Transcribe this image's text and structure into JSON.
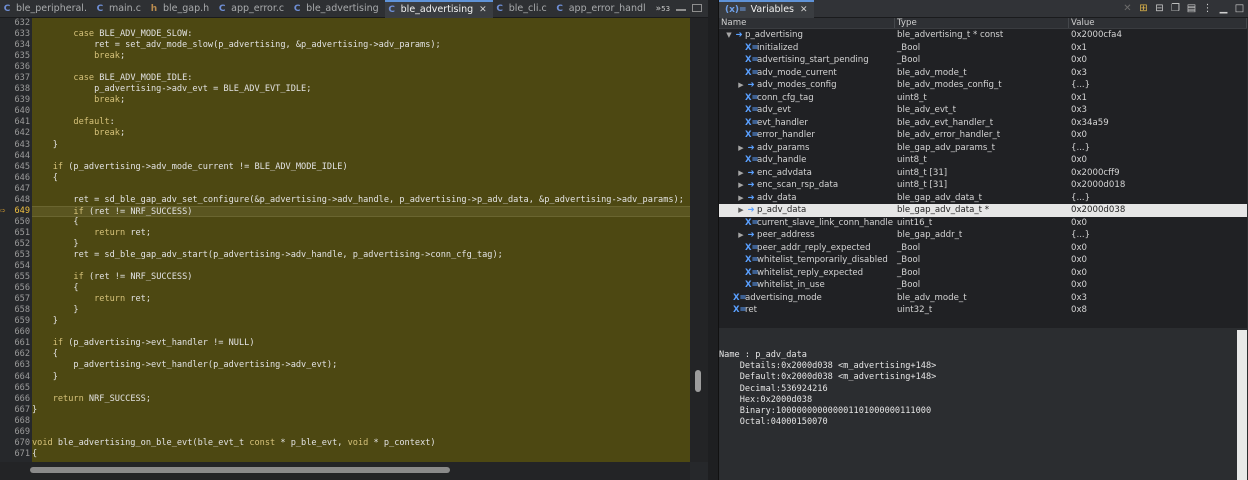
{
  "editor": {
    "tabs": [
      {
        "label": "ble_peripheral.",
        "kind": "c",
        "active": false
      },
      {
        "label": "main.c",
        "kind": "c",
        "active": false
      },
      {
        "label": "ble_gap.h",
        "kind": "h",
        "active": false
      },
      {
        "label": "app_error.c",
        "kind": "c",
        "active": false
      },
      {
        "label": "ble_advertising",
        "kind": "c",
        "active": false
      },
      {
        "label": "ble_advertising",
        "kind": "c",
        "active": true,
        "close": "✕"
      },
      {
        "label": "ble_cli.c",
        "kind": "c",
        "active": false
      },
      {
        "label": "app_error_handl",
        "kind": "c",
        "active": false
      }
    ],
    "overflow": "»",
    "overflow_count": "53",
    "current_line": "649",
    "lines": [
      {
        "n": "632",
        "t": ""
      },
      {
        "n": "633",
        "t": "        case BLE_ADV_MODE_SLOW:"
      },
      {
        "n": "634",
        "t": "            ret = set_adv_mode_slow(p_advertising, &p_advertising->adv_params);"
      },
      {
        "n": "635",
        "t": "            break;"
      },
      {
        "n": "636",
        "t": ""
      },
      {
        "n": "637",
        "t": "        case BLE_ADV_MODE_IDLE:"
      },
      {
        "n": "638",
        "t": "            p_advertising->adv_evt = BLE_ADV_EVT_IDLE;"
      },
      {
        "n": "639",
        "t": "            break;"
      },
      {
        "n": "640",
        "t": ""
      },
      {
        "n": "641",
        "t": "        default:"
      },
      {
        "n": "642",
        "t": "            break;"
      },
      {
        "n": "643",
        "t": "    }"
      },
      {
        "n": "644",
        "t": ""
      },
      {
        "n": "645",
        "t": "    if (p_advertising->adv_mode_current != BLE_ADV_MODE_IDLE)"
      },
      {
        "n": "646",
        "t": "    {"
      },
      {
        "n": "647",
        "t": ""
      },
      {
        "n": "648",
        "t": "        ret = sd_ble_gap_adv_set_configure(&p_advertising->adv_handle, p_advertising->p_adv_data, &p_advertising->adv_params);"
      },
      {
        "n": "649",
        "t": "        if (ret != NRF_SUCCESS)"
      },
      {
        "n": "650",
        "t": "        {"
      },
      {
        "n": "651",
        "t": "            return ret;"
      },
      {
        "n": "652",
        "t": "        }"
      },
      {
        "n": "653",
        "t": "        ret = sd_ble_gap_adv_start(p_advertising->adv_handle, p_advertising->conn_cfg_tag);"
      },
      {
        "n": "654",
        "t": ""
      },
      {
        "n": "655",
        "t": "        if (ret != NRF_SUCCESS)"
      },
      {
        "n": "656",
        "t": "        {"
      },
      {
        "n": "657",
        "t": "            return ret;"
      },
      {
        "n": "658",
        "t": "        }"
      },
      {
        "n": "659",
        "t": "    }"
      },
      {
        "n": "660",
        "t": ""
      },
      {
        "n": "661",
        "t": "    if (p_advertising->evt_handler != NULL)"
      },
      {
        "n": "662",
        "t": "    {"
      },
      {
        "n": "663",
        "t": "        p_advertising->evt_handler(p_advertising->adv_evt);"
      },
      {
        "n": "664",
        "t": "    }"
      },
      {
        "n": "665",
        "t": ""
      },
      {
        "n": "666",
        "t": "    return NRF_SUCCESS;"
      },
      {
        "n": "667",
        "t": "}"
      },
      {
        "n": "668",
        "t": ""
      },
      {
        "n": "669",
        "t": ""
      },
      {
        "n": "670",
        "t": "void ble_advertising_on_ble_evt(ble_evt_t const * p_ble_evt, void * p_context)"
      },
      {
        "n": "671",
        "t": "{"
      }
    ]
  },
  "variables": {
    "tab_label": "Variables",
    "tab_icon": "(x)=",
    "columns": {
      "name": "Name",
      "type": "Type",
      "value": "Value"
    },
    "rows": [
      {
        "name": "p_advertising",
        "type": "ble_advertising_t * const",
        "value": "0x2000cfa4",
        "indent": 0,
        "exp": "▼",
        "icon": "➜"
      },
      {
        "name": "initialized",
        "type": "_Bool",
        "value": "0x1",
        "indent": 1,
        "exp": "",
        "icon": "X="
      },
      {
        "name": "advertising_start_pending",
        "type": "_Bool",
        "value": "0x0",
        "indent": 1,
        "exp": "",
        "icon": "X="
      },
      {
        "name": "adv_mode_current",
        "type": "ble_adv_mode_t",
        "value": "0x3",
        "indent": 1,
        "exp": "",
        "icon": "X="
      },
      {
        "name": "adv_modes_config",
        "type": "ble_adv_modes_config_t",
        "value": "{...}",
        "indent": 1,
        "exp": "▶",
        "icon": "➜"
      },
      {
        "name": "conn_cfg_tag",
        "type": "uint8_t",
        "value": "0x1",
        "indent": 1,
        "exp": "",
        "icon": "X="
      },
      {
        "name": "adv_evt",
        "type": "ble_adv_evt_t",
        "value": "0x3",
        "indent": 1,
        "exp": "",
        "icon": "X="
      },
      {
        "name": "evt_handler",
        "type": "ble_adv_evt_handler_t",
        "value": "0x34a59",
        "indent": 1,
        "exp": "",
        "icon": "X="
      },
      {
        "name": "error_handler",
        "type": "ble_adv_error_handler_t",
        "value": "0x0",
        "indent": 1,
        "exp": "",
        "icon": "X="
      },
      {
        "name": "adv_params",
        "type": "ble_gap_adv_params_t",
        "value": "{...}",
        "indent": 1,
        "exp": "▶",
        "icon": "➜"
      },
      {
        "name": "adv_handle",
        "type": "uint8_t",
        "value": "0x0",
        "indent": 1,
        "exp": "",
        "icon": "X="
      },
      {
        "name": "enc_advdata",
        "type": "uint8_t [31]",
        "value": "0x2000cff9",
        "indent": 1,
        "exp": "▶",
        "icon": "➜"
      },
      {
        "name": "enc_scan_rsp_data",
        "type": "uint8_t [31]",
        "value": "0x2000d018",
        "indent": 1,
        "exp": "▶",
        "icon": "➜"
      },
      {
        "name": "adv_data",
        "type": "ble_gap_adv_data_t",
        "value": "{...}",
        "indent": 1,
        "exp": "▶",
        "icon": "➜"
      },
      {
        "name": "p_adv_data",
        "type": "ble_gap_adv_data_t *",
        "value": "0x2000d038",
        "indent": 1,
        "exp": "▶",
        "icon": "➜",
        "selected": true
      },
      {
        "name": "current_slave_link_conn_handle",
        "type": "uint16_t",
        "value": "0x0",
        "indent": 1,
        "exp": "",
        "icon": "X="
      },
      {
        "name": "peer_address",
        "type": "ble_gap_addr_t",
        "value": "{...}",
        "indent": 1,
        "exp": "▶",
        "icon": "➜"
      },
      {
        "name": "peer_addr_reply_expected",
        "type": "_Bool",
        "value": "0x0",
        "indent": 1,
        "exp": "",
        "icon": "X="
      },
      {
        "name": "whitelist_temporarily_disabled",
        "type": "_Bool",
        "value": "0x0",
        "indent": 1,
        "exp": "",
        "icon": "X="
      },
      {
        "name": "whitelist_reply_expected",
        "type": "_Bool",
        "value": "0x0",
        "indent": 1,
        "exp": "",
        "icon": "X="
      },
      {
        "name": "whitelist_in_use",
        "type": "_Bool",
        "value": "0x0",
        "indent": 1,
        "exp": "",
        "icon": "X="
      },
      {
        "name": "advertising_mode",
        "type": "ble_adv_mode_t",
        "value": "0x3",
        "indent": 0,
        "exp": "",
        "icon": "X="
      },
      {
        "name": "ret",
        "type": "uint32_t",
        "value": "0x8",
        "indent": 0,
        "exp": "",
        "icon": "X="
      }
    ],
    "details": [
      "Name : p_adv_data",
      "    Details:0x2000d038 <m_advertising+148>",
      "    Default:0x2000d038 <m_advertising+148>",
      "    Decimal:536924216",
      "    Hex:0x2000d038",
      "    Binary:100000000000001101000000111000",
      "    Octal:04000150070"
    ]
  }
}
